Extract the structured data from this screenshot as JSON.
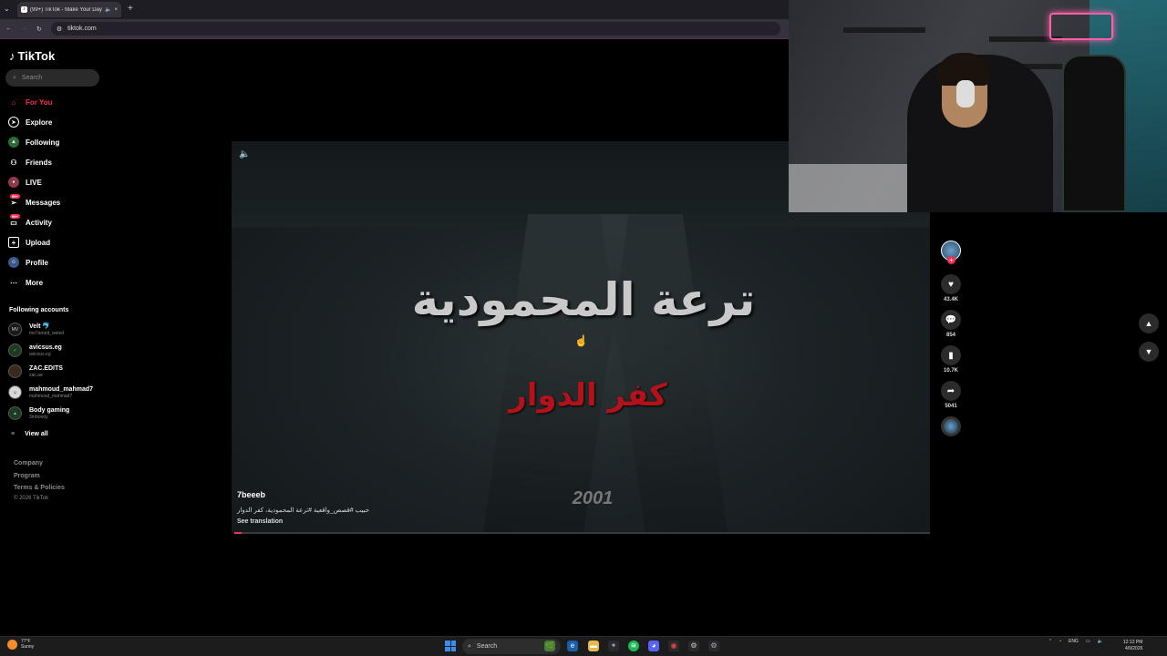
{
  "browser": {
    "tab_title": "(99+) TikTok - Make Your Day",
    "tab_close": "×",
    "new_tab": "+",
    "url": "tiktok.com"
  },
  "sidebar": {
    "logo_text": "TikTok",
    "search_placeholder": "Search",
    "nav": [
      {
        "label": "For You",
        "icon": "home-icon",
        "color": "#fe2c55",
        "active": true
      },
      {
        "label": "Explore",
        "icon": "compass-icon"
      },
      {
        "label": "Following",
        "icon": "following-icon"
      },
      {
        "label": "Friends",
        "icon": "friends-icon"
      },
      {
        "label": "LIVE",
        "icon": "live-icon"
      },
      {
        "label": "Messages",
        "icon": "messages-icon",
        "badge": "99+"
      },
      {
        "label": "Activity",
        "icon": "activity-icon",
        "badge": "99+"
      },
      {
        "label": "Upload",
        "icon": "upload-icon"
      },
      {
        "label": "Profile",
        "icon": "profile-icon"
      },
      {
        "label": "More",
        "icon": "more-icon"
      }
    ],
    "following_title": "Following accounts",
    "accounts": [
      {
        "name": "Velt 🐬",
        "handle": "mo7amed_weled"
      },
      {
        "name": "avicsus.eg",
        "handle": "avicsus.eg"
      },
      {
        "name": "ZAC.EDITS",
        "handle": "zac.ae"
      },
      {
        "name": "mahmoud_mahmad7",
        "handle": "mahmoud_mahmad7"
      },
      {
        "name": "Body gaming",
        "handle": "3mboody"
      }
    ],
    "view_all": "View all",
    "footer": [
      "Company",
      "Program",
      "Terms & Policies"
    ],
    "copyright": "© 2026 TikTok"
  },
  "video": {
    "title_ar": "ترعة المحمودية",
    "subtitle_ar": "كفر الدوار",
    "year": "2001",
    "author": "7beeeb",
    "caption": "حبيب #قصص_واقعية #ترعة المحمودية، كفر الدوار",
    "see_translation": "See translation",
    "progress": 0.01
  },
  "actions": {
    "likes": "43.4K",
    "comments": "854",
    "saves": "10.7K",
    "shares": "5041"
  },
  "taskbar": {
    "weather_temp": "77°F",
    "weather_desc": "Sunny",
    "search": "Search",
    "lang": "ENG",
    "time": "12:12 PM",
    "date": "4/9/2026"
  }
}
